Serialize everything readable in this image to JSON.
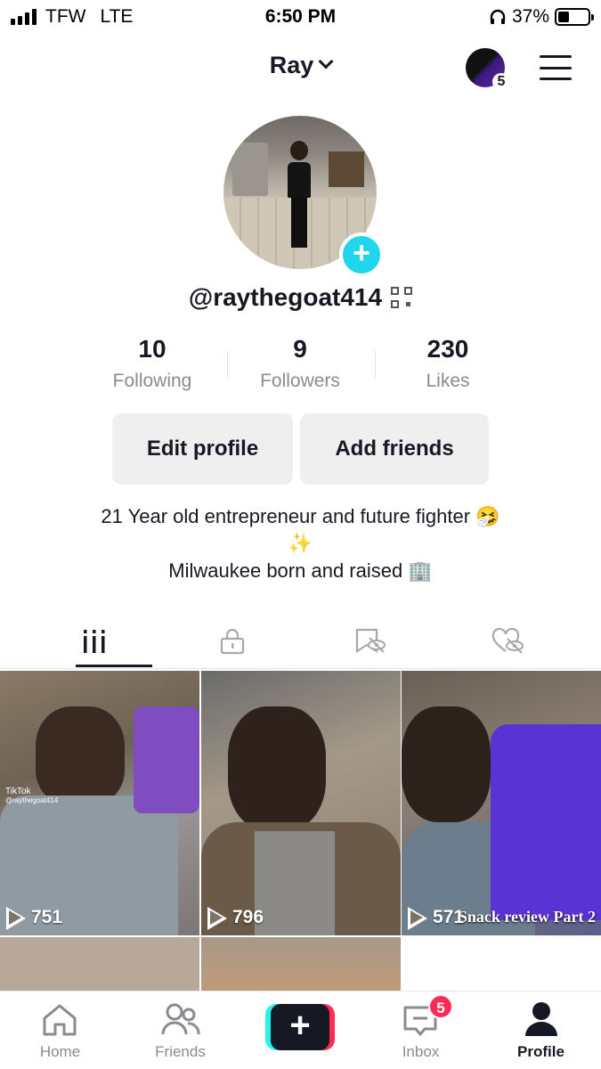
{
  "status_bar": {
    "carrier": "TFW",
    "network": "LTE",
    "time": "6:50 PM",
    "battery": "37%",
    "battery_level": 0.37
  },
  "header": {
    "title": "Ray",
    "story_count": "5"
  },
  "profile": {
    "username": "@raythegoat414",
    "stats": [
      {
        "value": "10",
        "label": "Following"
      },
      {
        "value": "9",
        "label": "Followers"
      },
      {
        "value": "230",
        "label": "Likes"
      }
    ],
    "buttons": {
      "edit": "Edit profile",
      "add": "Add friends"
    },
    "bio": [
      "21 Year old entrepreneur and future fighter 🤧",
      "✨",
      "Milwaukee born and raised 🏢"
    ]
  },
  "tabs": [
    "videos-icon",
    "lock-icon",
    "saved-icon",
    "liked-icon"
  ],
  "videos": [
    {
      "views": "751",
      "watermark": "TikTok",
      "watermark_user": "@raythegoat414"
    },
    {
      "views": "796"
    },
    {
      "views": "571",
      "caption": "Snack review Part 2"
    }
  ],
  "bottom_nav": [
    {
      "label": "Home"
    },
    {
      "label": "Friends"
    },
    {
      "label": "+"
    },
    {
      "label": "Inbox",
      "badge": "5"
    },
    {
      "label": "Profile"
    }
  ]
}
